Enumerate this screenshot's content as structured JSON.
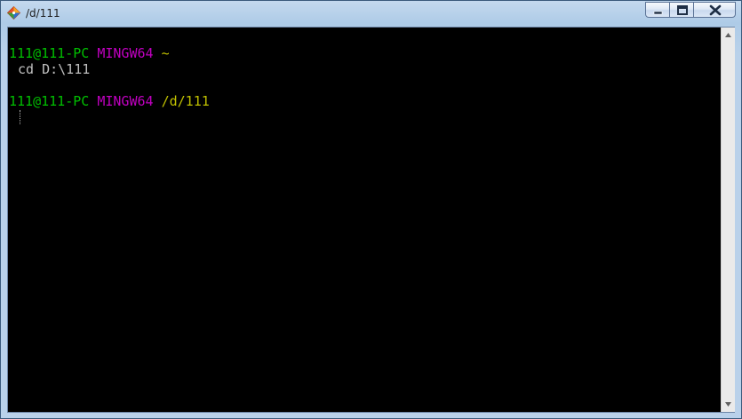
{
  "window": {
    "title": "/d/111",
    "icon": "git-bash-icon"
  },
  "controls": {
    "minimize": "minimize-icon",
    "maximize": "maximize-icon",
    "close": "close-icon"
  },
  "terminal": {
    "prompt1": {
      "user_host": "111@111-PC",
      "system": "MINGW64",
      "path": "~"
    },
    "command1": "cd D:\\111",
    "prompt2": {
      "user_host": "111@111-PC",
      "system": "MINGW64",
      "path": "/d/111"
    }
  },
  "colors": {
    "user_host": "#00c000",
    "system": "#c000c0",
    "path": "#c0c000",
    "text": "#c0c0c0",
    "background": "#000000"
  }
}
